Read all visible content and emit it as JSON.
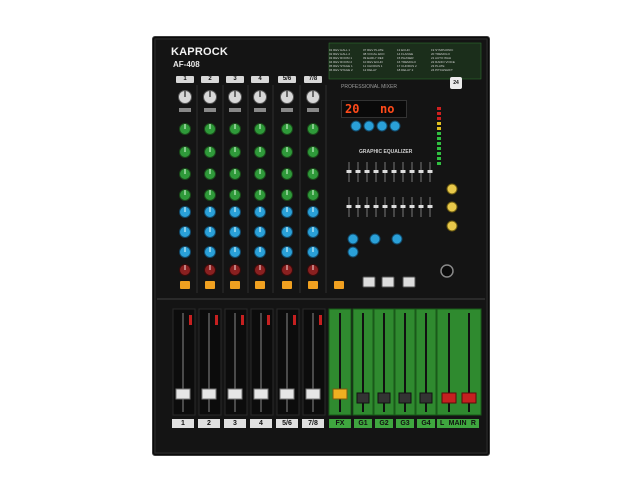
{
  "brand": "KAPROCK",
  "model": "AF-408",
  "channels": {
    "top_labels": [
      "1",
      "2",
      "3",
      "4",
      "5/6",
      "7/8"
    ],
    "bottom_labels": [
      "1",
      "2",
      "3",
      "4",
      "5/6",
      "7/8"
    ]
  },
  "groups": {
    "fx_label": "FX",
    "group_labels": [
      "G1",
      "G2",
      "G3",
      "G4"
    ],
    "main_left": "L",
    "main_title": "MAIN",
    "main_right": "R"
  },
  "fx_panel": {
    "title": "PROFESSIONAL MIXER",
    "display_left": "20",
    "display_right": "no",
    "badge": "24"
  },
  "effects": [
    "01 REV HALL 1",
    "02 REV HALL 2",
    "03 REV ROOM 1",
    "04 REV ROOM 2",
    "05 REV STAGE 1",
    "06 REV STAGE 2",
    "07 REV PLATE",
    "08 VOCAL EKO",
    "09 EARLY REF",
    "10 REV ECHO",
    "11 CHORUS 1",
    "12 DELAY",
    "13 ECHO",
    "14 FLANGE",
    "15 PHASER",
    "16 TREMOLO",
    "17 CHORUS 2",
    "18 DELAY 2",
    "19 SYMPHONIC",
    "20 TREMOLO",
    "21 AUTO WAH",
    "22 RADIO VOICE",
    "23 PLATE",
    "24 PITCHSHIFT"
  ],
  "eq": {
    "title": "GRAPHIC EQUALIZER"
  },
  "colors": {
    "body": "#141414",
    "accent_green": "#3fa63f",
    "knob_green": "#2f9a3a",
    "knob_blue": "#2aa0d8",
    "knob_white": "#d8d8d8",
    "button_orange": "#f0a020",
    "fader_red": "#c62020"
  }
}
